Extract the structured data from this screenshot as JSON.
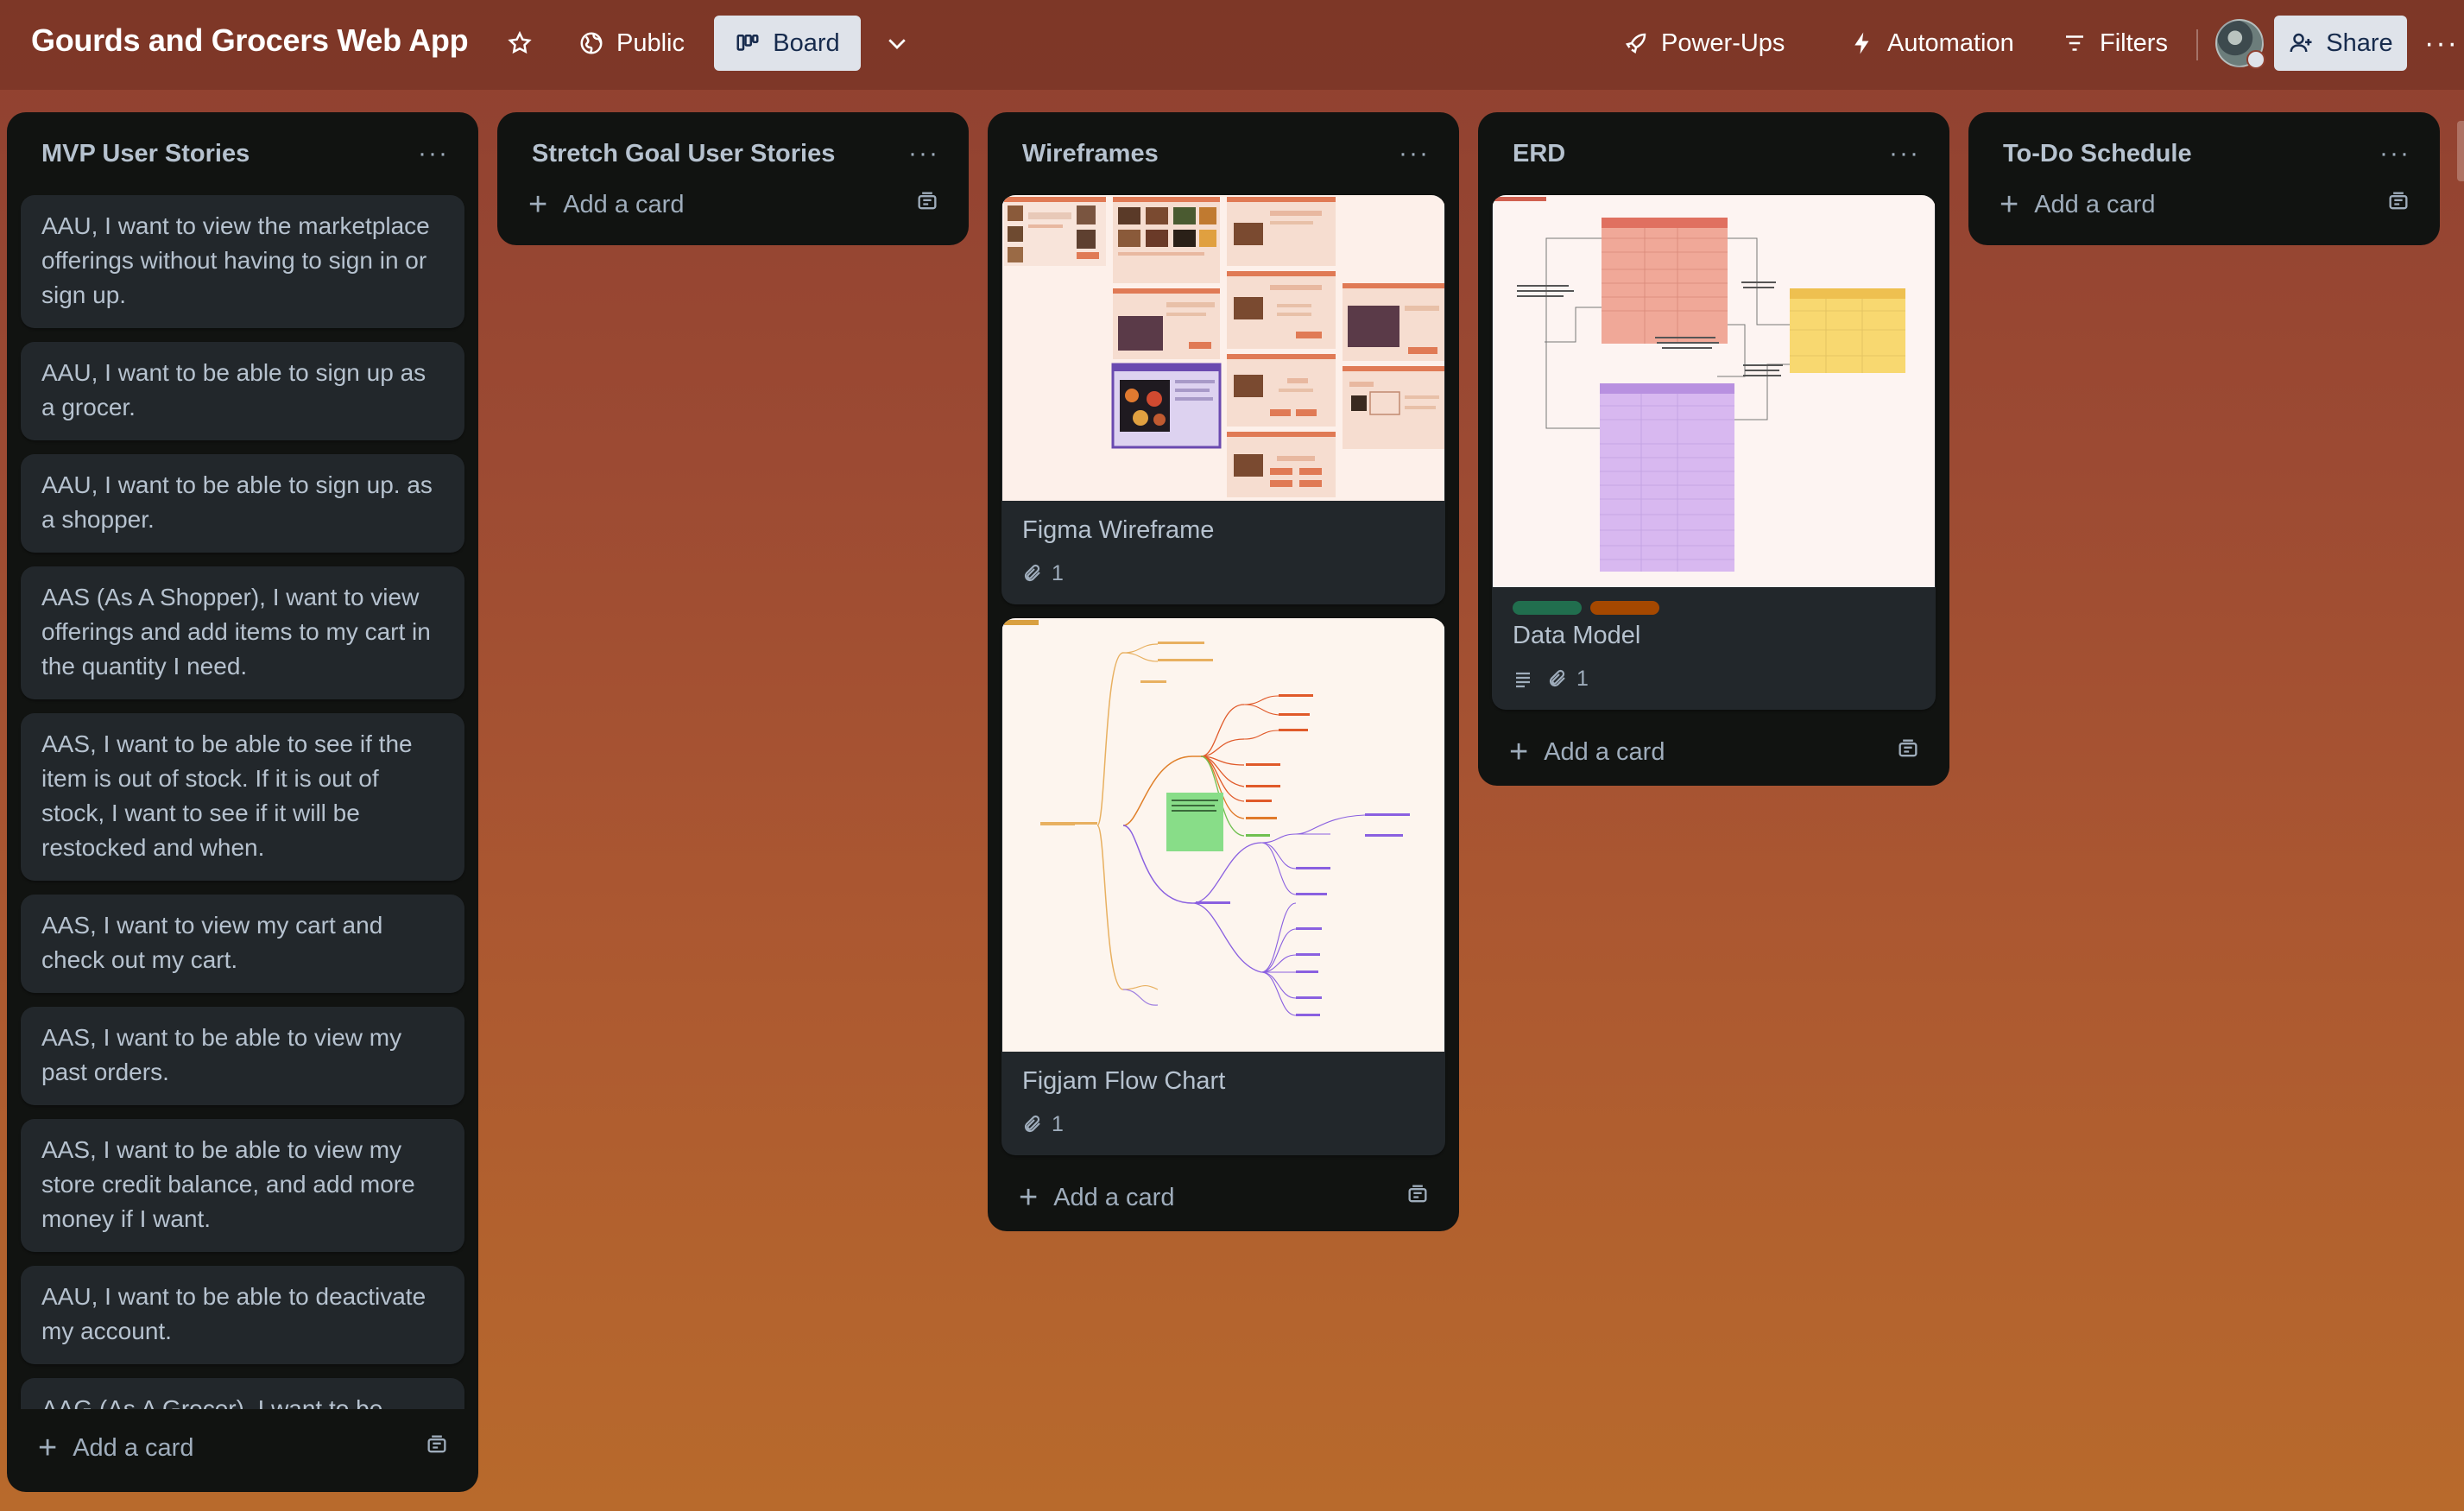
{
  "header": {
    "board_title": "Gourds and Grocers Web App",
    "visibility_label": "Public",
    "view_label": "Board",
    "powerups_label": "Power-Ups",
    "automation_label": "Automation",
    "filters_label": "Filters",
    "share_label": "Share"
  },
  "lists": [
    {
      "title": "MVP User Stories",
      "cards": [
        "AAU, I want to view the marketplace offerings without having to sign in or sign up.",
        "AAU, I want to be able to sign up as a grocer.",
        "AAU, I want to be able to sign up. as a shopper.",
        "AAS (As A Shopper), I want to view offerings and add items to my cart in the quantity I need.",
        "AAS, I want to be able to see if the item is out of stock. If it is out of stock, I want to see if it will be restocked and when.",
        "AAS, I want to view my cart and check out my cart.",
        "AAS, I want to be able to view my past orders.",
        "AAS, I want to be able to view my store credit balance, and add more money if I want.",
        "AAU, I want to be able to deactivate my account.",
        "AAG (As A Grocer), I want to be"
      ],
      "add_card": "Add a card"
    },
    {
      "title": "Stretch Goal User Stories",
      "add_card": "Add a card"
    },
    {
      "title": "Wireframes",
      "cards": [
        {
          "title": "Figma Wireframe",
          "attachments": "1"
        },
        {
          "title": "Figjam Flow Chart",
          "attachments": "1"
        }
      ],
      "add_card": "Add a card"
    },
    {
      "title": "ERD",
      "cards": [
        {
          "title": "Data Model",
          "attachments": "1",
          "label_colors": [
            "#216e4e",
            "#a54800"
          ]
        }
      ],
      "add_card": "Add a card"
    },
    {
      "title": "To-Do Schedule",
      "add_card": "Add a card"
    }
  ],
  "colors": {
    "list_bg": "#111311",
    "card_bg": "#22272b",
    "text": "#b6c2cf",
    "label_green": "#216e4e",
    "label_orange": "#a54800"
  }
}
